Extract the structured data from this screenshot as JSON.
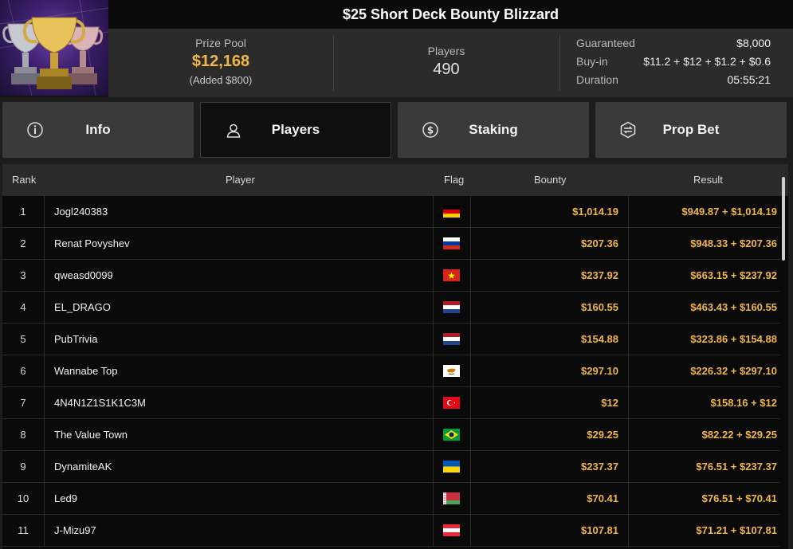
{
  "header": {
    "title": "$25 Short Deck Bounty Blizzard",
    "prize_pool_label": "Prize Pool",
    "prize_pool_value": "$12,168",
    "prize_added": "(Added $800)",
    "players_label": "Players",
    "players_value": "490",
    "details": [
      {
        "label": "Guaranteed",
        "value": "$8,000"
      },
      {
        "label": "Buy-in",
        "value": "$11.2 + $12 + $1.2 + $0.6"
      },
      {
        "label": "Duration",
        "value": "05:55:21"
      }
    ]
  },
  "tabs": [
    {
      "label": "Info",
      "icon": "info-icon",
      "active": false
    },
    {
      "label": "Players",
      "icon": "user-icon",
      "active": true
    },
    {
      "label": "Staking",
      "icon": "dollar-circle-icon",
      "active": false
    },
    {
      "label": "Prop Bet",
      "icon": "prop-bet-icon",
      "active": false
    }
  ],
  "table": {
    "headers": {
      "rank": "Rank",
      "player": "Player",
      "flag": "Flag",
      "bounty": "Bounty",
      "result": "Result"
    },
    "rows": [
      {
        "rank": "1",
        "player": "Jogl240383",
        "flag": "germany",
        "bounty": "$1,014.19",
        "result": "$949.87 + $1,014.19"
      },
      {
        "rank": "2",
        "player": "Renat Povyshev",
        "flag": "russia",
        "bounty": "$207.36",
        "result": "$948.33 + $207.36"
      },
      {
        "rank": "3",
        "player": "qweasd0099",
        "flag": "vietnam",
        "bounty": "$237.92",
        "result": "$663.15 + $237.92"
      },
      {
        "rank": "4",
        "player": "EL_DRAGO",
        "flag": "netherlands",
        "bounty": "$160.55",
        "result": "$463.43 + $160.55"
      },
      {
        "rank": "5",
        "player": "PubTrivia",
        "flag": "netherlands",
        "bounty": "$154.88",
        "result": "$323.86 + $154.88"
      },
      {
        "rank": "6",
        "player": "Wannabe Top",
        "flag": "cyprus",
        "bounty": "$297.10",
        "result": "$226.32 + $297.10"
      },
      {
        "rank": "7",
        "player": "4N4N1Z1S1K1C3M",
        "flag": "turkey",
        "bounty": "$12",
        "result": "$158.16 + $12"
      },
      {
        "rank": "8",
        "player": "The Value Town",
        "flag": "brazil",
        "bounty": "$29.25",
        "result": "$82.22 + $29.25"
      },
      {
        "rank": "9",
        "player": "DynamiteAK",
        "flag": "ukraine",
        "bounty": "$237.37",
        "result": "$76.51 + $237.37"
      },
      {
        "rank": "10",
        "player": "Led9",
        "flag": "belarus",
        "bounty": "$70.41",
        "result": "$76.51 + $70.41"
      },
      {
        "rank": "11",
        "player": "J-Mizu97",
        "flag": "austria",
        "bounty": "$107.81",
        "result": "$71.21 + $107.81"
      }
    ]
  },
  "colors": {
    "accent_gold": "#f0b64a",
    "background": "#0a0a0a",
    "tab_bg": "#3a3a3a",
    "tab_active_bg": "#0f0f0f"
  }
}
